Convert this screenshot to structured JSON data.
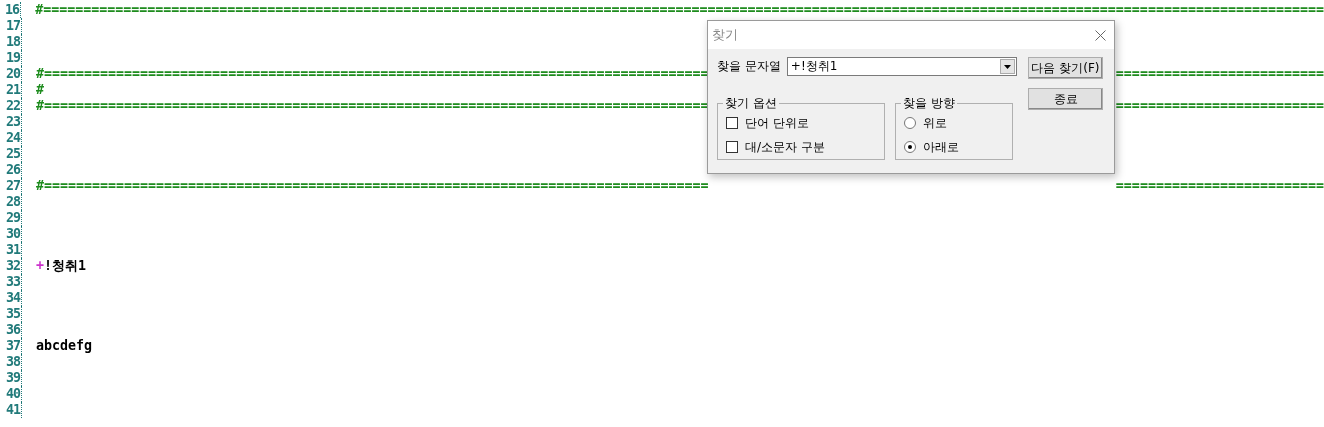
{
  "editor": {
    "lines": [
      {
        "number": "16",
        "parts": [
          {
            "text": "#================================================================================================================================================================",
            "color": "#1e8c1e"
          }
        ]
      },
      {
        "number": "17"
      },
      {
        "number": "18"
      },
      {
        "number": "19"
      },
      {
        "number": "20",
        "parts": [
          {
            "text": "#===================================================================================",
            "color": "#1e8c1e"
          },
          {
            "text": "==========================",
            "color": "#1e8c1e"
          }
        ]
      },
      {
        "number": "21",
        "parts": [
          {
            "text": "#",
            "color": "#1e8c1e"
          }
        ]
      },
      {
        "number": "22",
        "parts": [
          {
            "text": "#===================================================================================",
            "color": "#1e8c1e"
          },
          {
            "text": "==========================",
            "color": "#1e8c1e"
          }
        ]
      },
      {
        "number": "23"
      },
      {
        "number": "24"
      },
      {
        "number": "25"
      },
      {
        "number": "26"
      },
      {
        "number": "27",
        "parts": [
          {
            "text": "#===================================================================================",
            "color": "#1e8c1e"
          },
          {
            "text": "==========================",
            "color": "#1e8c1e"
          }
        ]
      },
      {
        "number": "28"
      },
      {
        "number": "29"
      },
      {
        "number": "30"
      },
      {
        "number": "31"
      },
      {
        "number": "32",
        "parts": [
          {
            "text": "+",
            "color": "#cc33cc"
          },
          {
            "text": "!청취1",
            "color": "#000000"
          }
        ]
      },
      {
        "number": "33"
      },
      {
        "number": "34"
      },
      {
        "number": "35"
      },
      {
        "number": "36"
      },
      {
        "number": "37",
        "parts": [
          {
            "text": "abcdefg",
            "color": "#000000"
          }
        ]
      },
      {
        "number": "38"
      },
      {
        "number": "39"
      },
      {
        "number": "40"
      },
      {
        "number": "41"
      }
    ]
  },
  "find_dialog": {
    "title": "찾기",
    "search_label": "찾을 문자열",
    "search_value": "+!청취1",
    "buttons": [
      {
        "label": "다음 찾기(F)"
      },
      {
        "label": "종료"
      }
    ],
    "options_group": {
      "title": "찾기 옵션",
      "options": [
        {
          "label": "단어 단위로",
          "checked": false
        },
        {
          "label": "대/소문자 구분",
          "checked": false
        }
      ]
    },
    "direction_group": {
      "title": "찾을 방향",
      "options": [
        {
          "label": "위로",
          "selected": false
        },
        {
          "label": "아래로",
          "selected": true
        }
      ]
    }
  }
}
